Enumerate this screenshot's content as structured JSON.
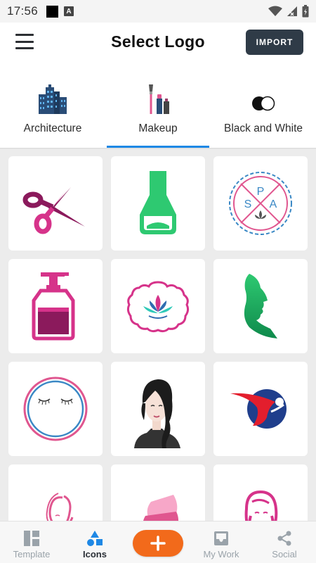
{
  "status_bar": {
    "time": "17:56"
  },
  "header": {
    "title": "Select Logo",
    "import_label": "IMPORT"
  },
  "categories": [
    {
      "label": "Architecture",
      "icon": "buildings-icon"
    },
    {
      "label": "Makeup",
      "icon": "makeup-brush-icon",
      "selected": true
    },
    {
      "label": "Black and White",
      "icon": "black-white-toggle-icon"
    }
  ],
  "logos": {
    "spa_letters": [
      "S",
      "P",
      "A"
    ]
  },
  "bottom_nav": {
    "items": [
      {
        "label": "Template",
        "icon": "template-grid-icon"
      },
      {
        "label": "Icons",
        "icon": "shapes-icon",
        "active": true
      },
      {
        "label": "My Work",
        "icon": "inbox-icon"
      },
      {
        "label": "Social",
        "icon": "share-icon"
      }
    ],
    "add_icon": "plus-icon"
  },
  "colors": {
    "accent_blue": "#1e88e5",
    "import_bg": "#2f3b47",
    "add_orange": "#f26a1b",
    "makeup_pink": "#d6338a",
    "makeup_purple": "#8b1a5c",
    "polish_green": "#2ec971"
  }
}
